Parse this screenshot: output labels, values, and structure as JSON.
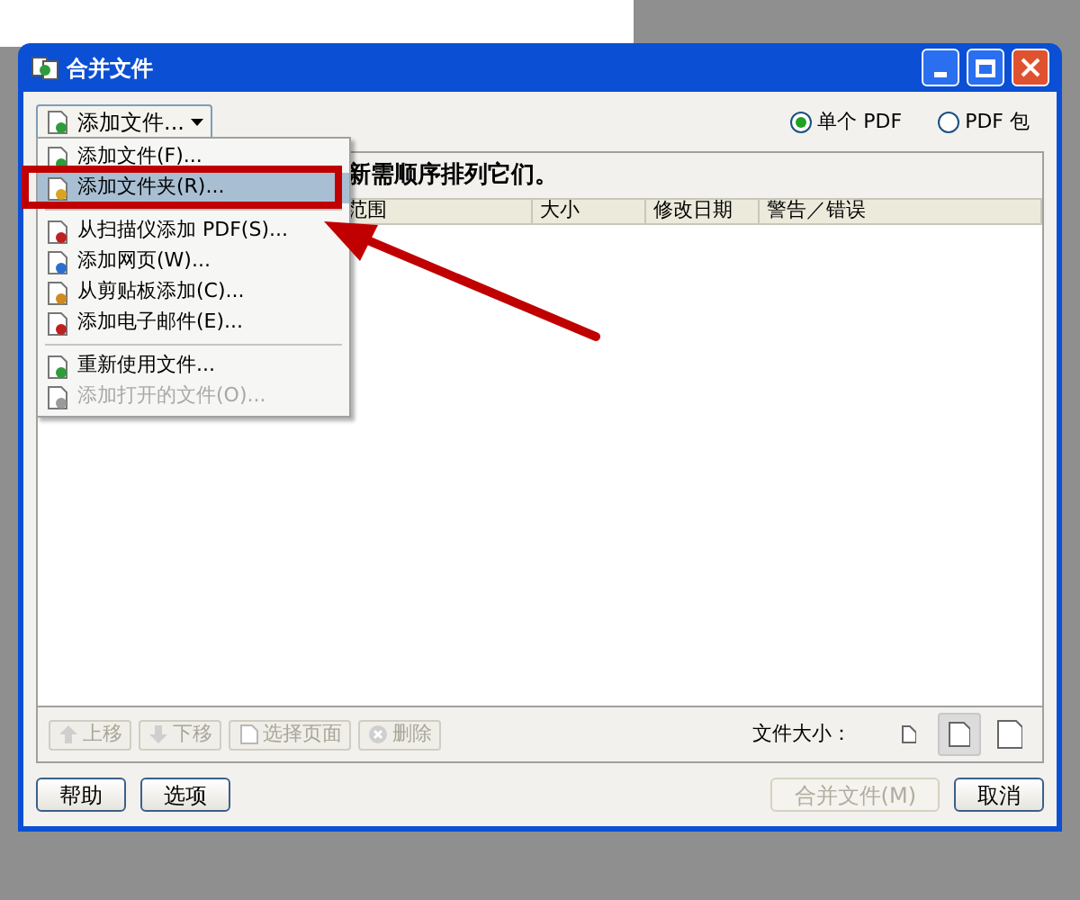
{
  "window": {
    "title": "合并文件"
  },
  "toolbar": {
    "add_button": "添加文件...",
    "output_options": [
      {
        "label": "单个 PDF",
        "selected": true
      },
      {
        "label": "PDF 包",
        "selected": false
      }
    ]
  },
  "add_menu": [
    {
      "kind": "item",
      "label": "添加文件(F)...",
      "selected": false,
      "disabled": false
    },
    {
      "kind": "item",
      "label": "添加文件夹(R)...",
      "selected": true,
      "disabled": false
    },
    {
      "kind": "separator"
    },
    {
      "kind": "item",
      "label": "从扫描仪添加 PDF(S)...",
      "selected": false,
      "disabled": false
    },
    {
      "kind": "item",
      "label": "添加网页(W)...",
      "selected": false,
      "disabled": false
    },
    {
      "kind": "item",
      "label": "从剪贴板添加(C)...",
      "selected": false,
      "disabled": false
    },
    {
      "kind": "item",
      "label": "添加电子邮件(E)...",
      "selected": false,
      "disabled": false
    },
    {
      "kind": "separator"
    },
    {
      "kind": "item",
      "label": "重新使用文件...",
      "selected": false,
      "disabled": false
    },
    {
      "kind": "item",
      "label": "添加打开的文件(O)...",
      "selected": false,
      "disabled": true
    }
  ],
  "instruction": "新需顺序排列它们。",
  "table": {
    "columns": [
      "范围",
      "大小",
      "修改日期",
      "警告／错误"
    ]
  },
  "list_buttons": [
    {
      "label": "上移",
      "disabled": true
    },
    {
      "label": "下移",
      "disabled": true
    },
    {
      "label": "选择页面",
      "disabled": true
    },
    {
      "label": "删除",
      "disabled": true
    }
  ],
  "file_size": {
    "label": "文件大小：",
    "options": [
      {
        "selected": false
      },
      {
        "selected": true
      },
      {
        "selected": false
      }
    ]
  },
  "footer": {
    "left": [
      {
        "label": "帮助",
        "disabled": false
      },
      {
        "label": "选项",
        "disabled": false
      }
    ],
    "right": [
      {
        "label": "合并文件(M)",
        "disabled": true
      },
      {
        "label": "取消",
        "disabled": false
      }
    ]
  }
}
